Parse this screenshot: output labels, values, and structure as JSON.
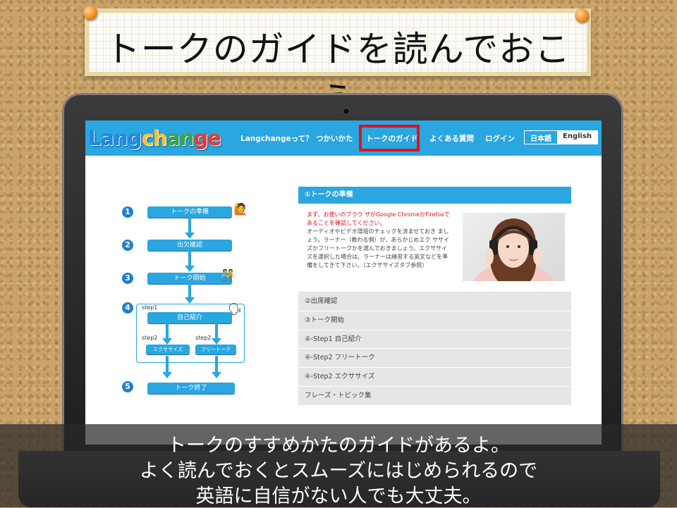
{
  "title": "トークのガイドを読んでおこう",
  "logo": {
    "parts": [
      "Lang",
      "ch",
      "an",
      "ge"
    ]
  },
  "nav": {
    "items": [
      "Langchangeって？",
      "つかいかた",
      "トークのガイド",
      "よくある質問",
      "ログイン"
    ],
    "lang": {
      "ja": "日本語",
      "en": "English"
    }
  },
  "flow": {
    "numbers": [
      "1",
      "2",
      "3",
      "4",
      "5"
    ],
    "boxes": [
      "トークの準備",
      "出欠確認",
      "トーク開始",
      "自己紹介",
      "エクササイズ",
      "フリートーク",
      "トーク終了"
    ],
    "step1": "step1",
    "step2a": "step2",
    "step2b": "step2"
  },
  "panel": {
    "header": "①トークの準備",
    "red_text": "まず、お使いのブラウ ザがGoogle ChromeかFirefoxであることを確認してください。",
    "body_text": "オーディオやビデオ環境のチェックを済ませておき ましょう。ラーナー（教わる側）が、あらかじめエク ササイズかフリートークかを選んでおきましょう。エクササイズを選択した場合は、ラーナーは練習する英文などを準備をしてきて下さい。（エクササイズタブ参照）",
    "accordion": [
      "②出席確認",
      "③トーク開始",
      "④-Step1 自己紹介",
      "④-Step2 フリートーク",
      "④-Step2 エクササイズ",
      "フレーズ・トピック集"
    ]
  },
  "caption": {
    "line1": "トークのすすめかたのガイドがあるよ。",
    "line2": "よく読んでおくとスムーズにはじめられるので",
    "line3": "英語に自信がない人でも大丈夫。"
  },
  "colors": {
    "brand": "#2aa6e0",
    "highlight": "#e0121a"
  }
}
